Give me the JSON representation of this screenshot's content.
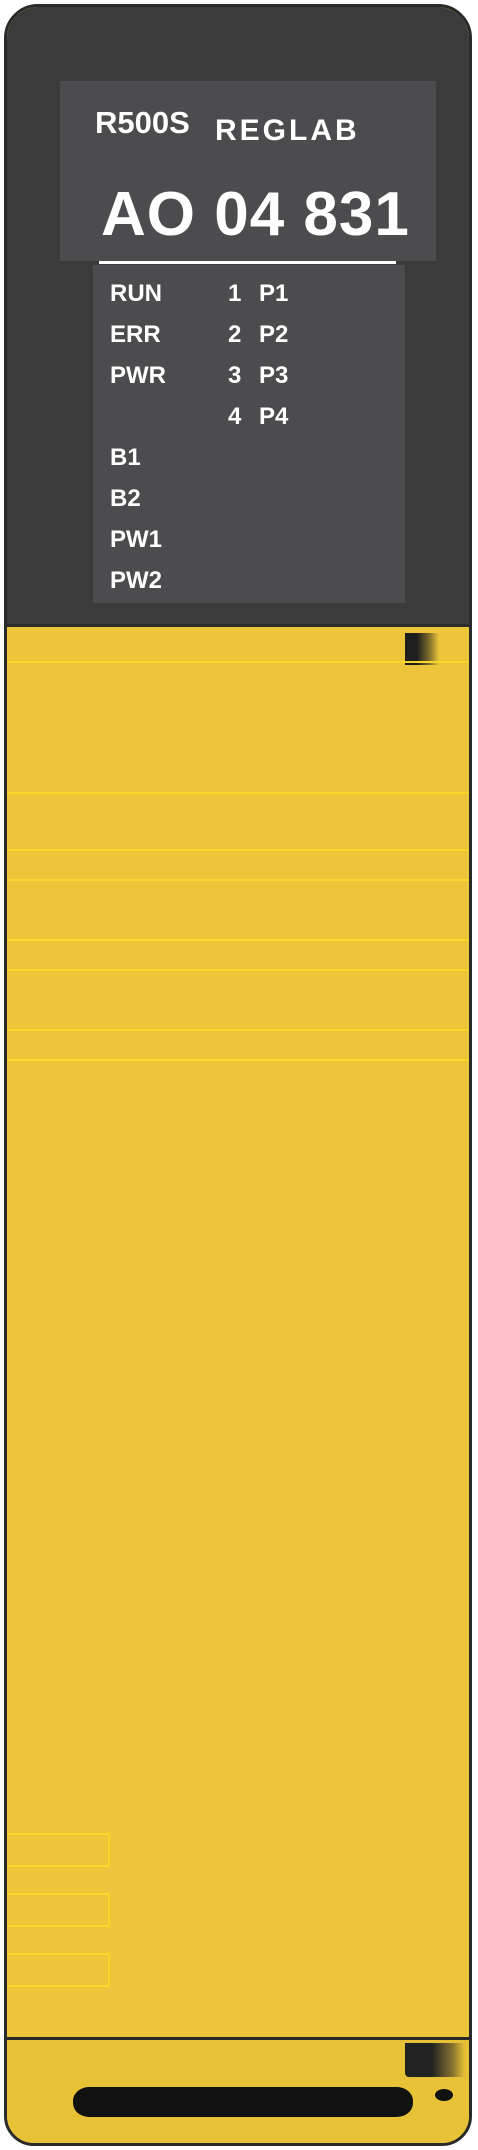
{
  "device": {
    "series": "R500S",
    "brand": "REGLAB",
    "model": "AO 04 831"
  },
  "status_leds": [
    "RUN",
    "ERR",
    "PWR",
    "",
    "B1",
    "B2",
    "PW1",
    "PW2"
  ],
  "channels": [
    {
      "number": "1",
      "label": "P1"
    },
    {
      "number": "2",
      "label": "P2"
    },
    {
      "number": "3",
      "label": "P3"
    },
    {
      "number": "4",
      "label": "P4"
    }
  ],
  "colors": {
    "top_panel": "#3b3b3c",
    "label_plate": "#4c4c4e",
    "housing": "#ecc53a",
    "accent_lines": "#f9d72a"
  }
}
